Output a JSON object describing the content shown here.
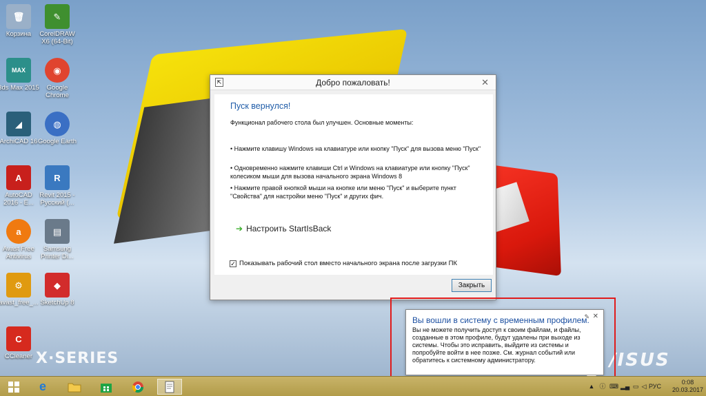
{
  "desktop": {
    "brand_left": "X·SERIES",
    "brand_right": "/ISUS",
    "icons": [
      {
        "label": "Корзина",
        "glyph": "🗑",
        "color": "#9ab0c8"
      },
      {
        "label": "CorelDRAW X6 (64-Bit)",
        "glyph": "✎",
        "color": "#3f8f2f"
      },
      {
        "label": "3ds Max 2015",
        "glyph": "MAX",
        "color": "#2c8f8a"
      },
      {
        "label": "Google Chrome",
        "glyph": "◉",
        "color": "#e0442f"
      },
      {
        "label": "ArchiCAD 16",
        "glyph": "◢",
        "color": "#2a5f7a"
      },
      {
        "label": "Google Earth",
        "glyph": "◍",
        "color": "#3a6fc4"
      },
      {
        "label": "AutoCAD 2016 - Е...",
        "glyph": "A",
        "color": "#c8201c"
      },
      {
        "label": "Revit 2015 - Русский (...",
        "glyph": "R",
        "color": "#3a79c0"
      },
      {
        "label": "Avast Free Antivirus",
        "glyph": "a",
        "color": "#f07a10"
      },
      {
        "label": "Samsung Printer Di...",
        "glyph": "▤",
        "color": "#6a7a8a"
      },
      {
        "label": "avast_free_...",
        "glyph": "⚙",
        "color": "#e09a10"
      },
      {
        "label": "SketchUp 8",
        "glyph": "◆",
        "color": "#d22c2c"
      },
      {
        "label": "CCleaner",
        "glyph": "C",
        "color": "#d62a1e"
      }
    ]
  },
  "dialog": {
    "title": "Добро пожаловать!",
    "heading": "Пуск вернулся!",
    "intro": "Функционал рабочего стола был улучшен. Основные моменты:",
    "bullets": [
      "• Нажмите клавишу Windows на клавиатуре или кнопку \"Пуск\" для вызова меню \"Пуск\"",
      "• Одновременно нажмите клавиши Ctrl и Windows на клавиатуре или кнопку \"Пуск\" колесиком мыши для вызова начального экрана Windows 8",
      "• Нажмите правой кнопкой мыши на кнопке или меню \"Пуск\" и выберите пункт \"Свойства\" для настройки меню \"Пуск\" и других фич."
    ],
    "config_link": "Настроить StartIsBack",
    "checkbox_label": "Показывать рабочий стол вместо начального экрана после загрузки ПК",
    "checkbox_checked": true,
    "close_button": "Закрыть"
  },
  "notification": {
    "title": "Вы вошли в систему с временным профилем.",
    "body": "Вы не можете получить доступ к своим файлам, и файлы, созданные в этом профиле, будут удалены при выходе из системы. Чтобы это исправить, выйдите из системы и попробуйте войти в нее позже. См. журнал событий или обратитесь к системному администратору."
  },
  "taskbar": {
    "language": "РУС",
    "time": "0:08",
    "date": "20.03.2017"
  }
}
